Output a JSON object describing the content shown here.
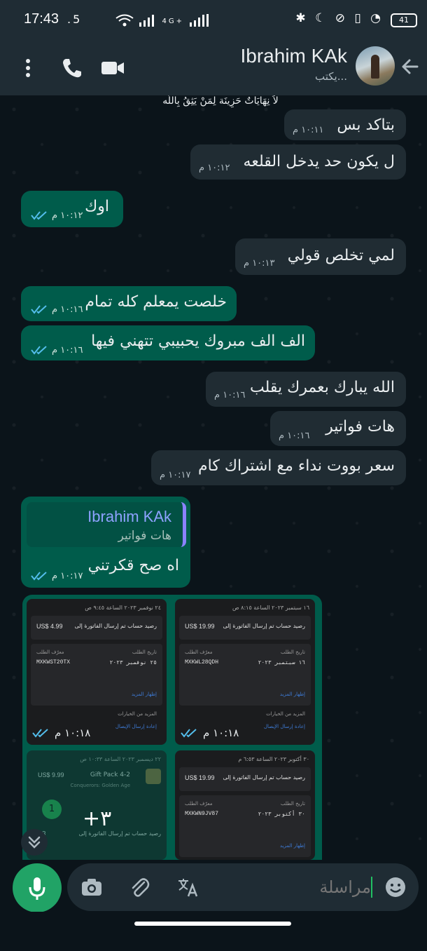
{
  "status_bar": {
    "time": "17:43",
    "speed": ".5",
    "network": "4G+",
    "battery": "41"
  },
  "header": {
    "contact_name": "Ibrahim KAk",
    "status": "يكتب..."
  },
  "quote_top": "لاَ نِهَايَاتٌ حَزِينَة لِمَنْ يَثِقُ بِاللَّه",
  "messages": [
    {
      "dir": "in",
      "text": "بتاكد بس",
      "time": "١٠:١١ م"
    },
    {
      "dir": "in",
      "text": "ل يكون حد يدخل القلعه",
      "time": "١٠:١٢ م"
    },
    {
      "dir": "out",
      "text": "اوك",
      "time": "١٠:١٢ م"
    },
    {
      "dir": "in",
      "text": "لمي تخلص قولي",
      "time": "١٠:١٣ م"
    },
    {
      "dir": "out",
      "text": "خلصت يمعلم كله تمام",
      "time": "١٠:١٦ م"
    },
    {
      "dir": "out",
      "text": "الف الف مبروك يحبيبي تتهني فيها",
      "time": "١٠:١٦ م"
    },
    {
      "dir": "in",
      "text": "الله يبارك بعمرك يقلب",
      "time": "١٠:١٦ م"
    },
    {
      "dir": "in",
      "text": "هات فواتير",
      "time": "١٠:١٦ م"
    },
    {
      "dir": "in",
      "text": "سعر بووت نداء مع اشتراك كام",
      "time": "١٠:١٧ م"
    }
  ],
  "reply_message": {
    "quoted_name": "Ibrahim KAk",
    "quoted_text": "هات فواتير",
    "text": "اه صح قكرتني",
    "time": "١٠:١٧ م"
  },
  "gallery": {
    "overflow_count": "+٣",
    "badge": "1",
    "thumbs": [
      {
        "top": "٢٤ نوفمبر ٢٠٢٣ الساعة ٩:٤٥ ص",
        "amount": "US$ 4.99",
        "desc": "رصيد حساب تم إرسال الفاتورة إلى",
        "order_id_label": "معرّف الطلب",
        "order_id": "MXKWST20TX",
        "date_label": "تاريخ الطلب",
        "date": "٢٥ نوفمبر ٢٠٢٣",
        "more": "إظهار المزيد",
        "options": "المزيد من الخيارات",
        "resend": "إعادة إرسال الإيصال",
        "time": "١٠:١٨ م"
      },
      {
        "top": "١٦ سبتمبر ٢٠٢٣ الساعة ٨:١٥ ص",
        "amount": "US$ 19.99",
        "desc": "رصيد حساب تم إرسال الفاتورة إلى",
        "order_id_label": "معرّف الطلب",
        "order_id": "MXKWL28QDH",
        "date_label": "تاريخ الطلب",
        "date": "١٦ سبتمبر ٢٠٢٣",
        "more": "إظهار المزيد",
        "options": "المزيد من الخيارات",
        "resend": "إعادة إرسال الإيصال",
        "time": "١٠:١٨ م"
      },
      {
        "top": "٢٢ ديسمبر ٢٠٢٣ الساعة ١٠:٣٣ ص",
        "amount": "US$ 9.99",
        "desc": "Gift Pack 4-2",
        "order_id_label": "Conquerors: Golden Age",
        "order_id": "",
        "date_label": "",
        "date": "",
        "more": "",
        "options": "",
        "resend": "",
        "time": ""
      },
      {
        "top": "٣٠ أكتوبر ٢٠٢٣ الساعة ٦:٥٣ م",
        "amount": "US$ 19.99",
        "desc": "رصيد حساب تم إرسال الفاتورة إلى",
        "order_id_label": "معرّف الطلب",
        "order_id": "MXKWN9JV87",
        "date_label": "تاريخ الطلب",
        "date": "٣٠ أكتوبر ٢٠٢٣",
        "more": "إظهار المزيد",
        "options": "",
        "resend": "",
        "time": ""
      }
    ],
    "partial_amount": "4.98",
    "partial_desc": "رصيد حساب تم إرسال الفاتورة إلى"
  },
  "composer": {
    "placeholder": "مراسلة"
  }
}
